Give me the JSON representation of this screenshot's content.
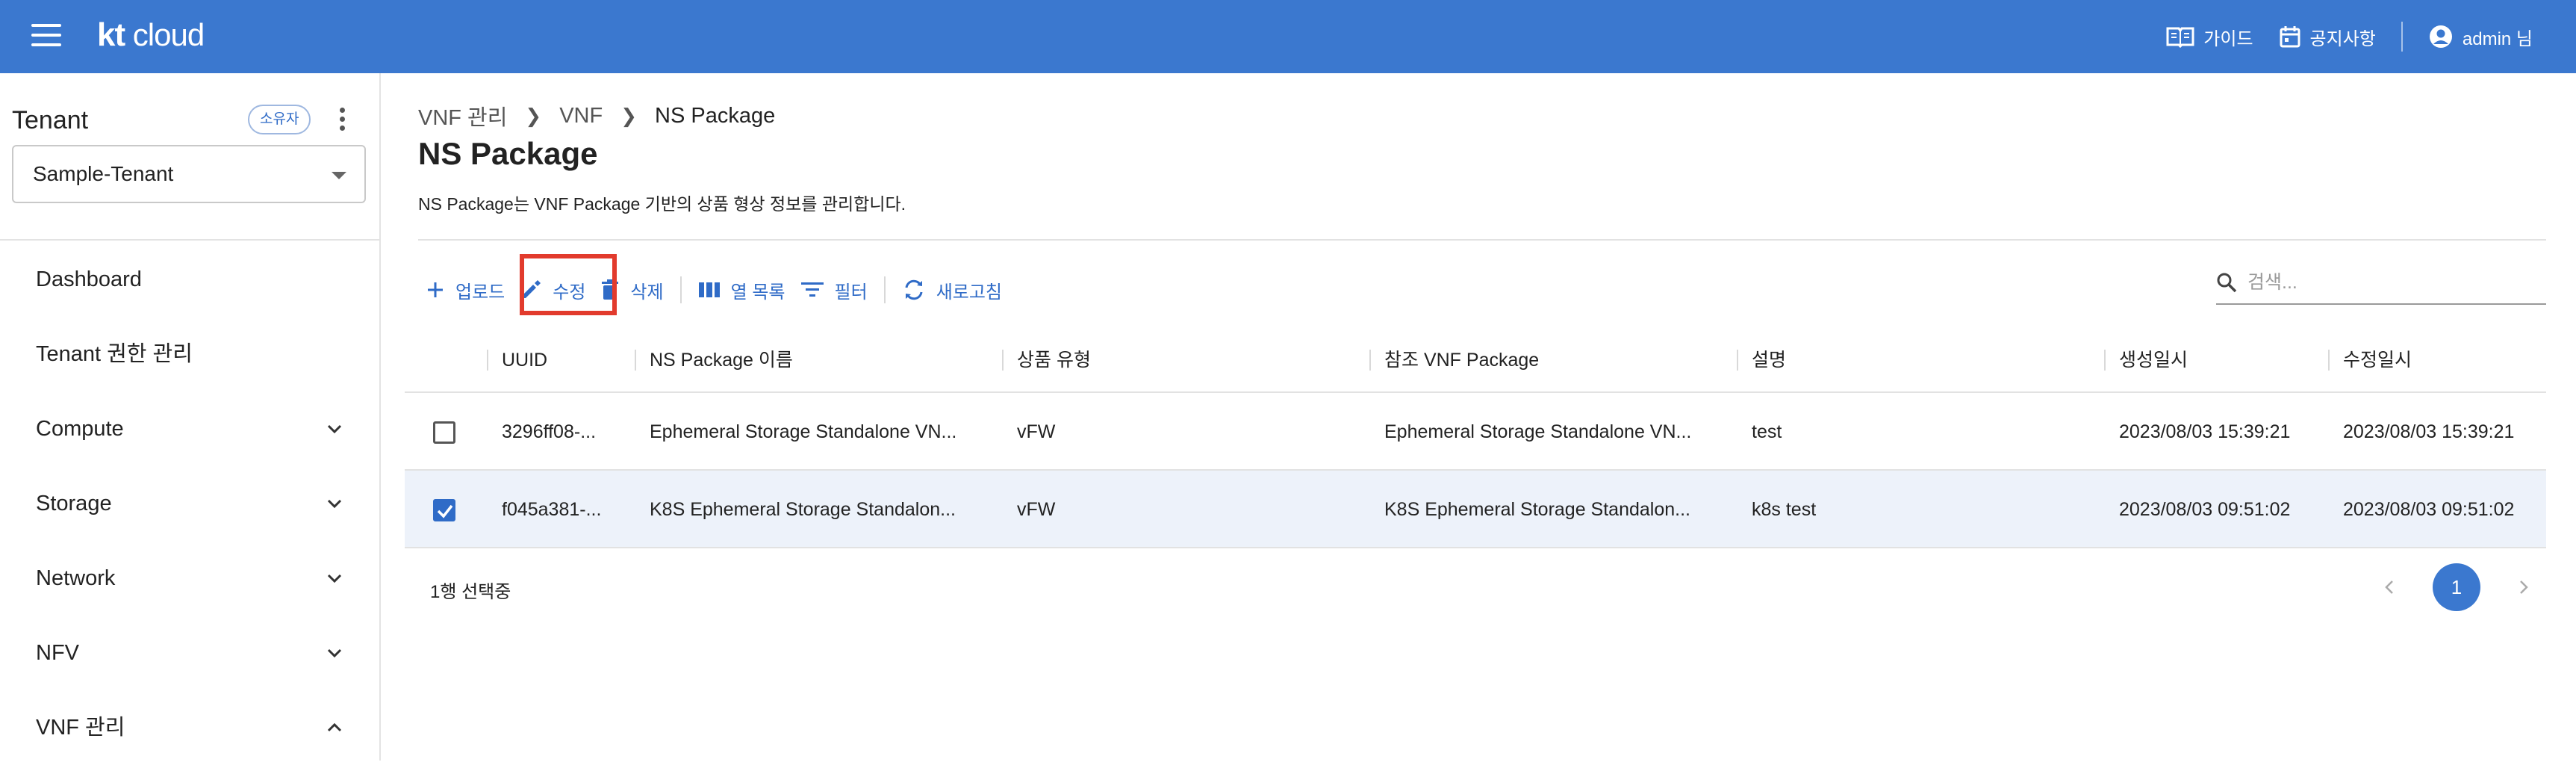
{
  "header": {
    "logo_kt": "kt",
    "logo_cloud": "cloud",
    "guide": "가이드",
    "notice": "공지사항",
    "user": "admin 님"
  },
  "sidebar": {
    "tenant_title": "Tenant",
    "owner_badge": "소유자",
    "tenant_selected": "Sample-Tenant",
    "items": [
      {
        "label": "Dashboard"
      },
      {
        "label": "Tenant 권한 관리"
      },
      {
        "label": "Compute"
      },
      {
        "label": "Storage"
      },
      {
        "label": "Network"
      },
      {
        "label": "NFV"
      },
      {
        "label": "VNF 관리"
      }
    ]
  },
  "breadcrumb": [
    "VNF 관리",
    "VNF",
    "NS Package"
  ],
  "page": {
    "title": "NS Package",
    "description": "NS Package는 VNF Package 기반의 상품 형상 정보를 관리합니다."
  },
  "toolbar": {
    "upload": "업로드",
    "edit": "수정",
    "delete": "삭제",
    "columns": "열 목록",
    "filter": "필터",
    "refresh": "새로고침"
  },
  "search": {
    "placeholder": "검색..."
  },
  "table": {
    "columns": [
      "UUID",
      "NS Package 이름",
      "상품 유형",
      "참조 VNF Package",
      "설명",
      "생성일시",
      "수정일시"
    ],
    "rows": [
      {
        "uuid": "3296ff08-...",
        "name": "Ephemeral Storage Standalone VN...",
        "type": "vFW",
        "ref": "Ephemeral Storage Standalone VN...",
        "desc": "test",
        "created": "2023/08/03 15:39:21",
        "modified": "2023/08/03 15:39:21",
        "checked": false
      },
      {
        "uuid": "f045a381-...",
        "name": "K8S Ephemeral Storage Standalon...",
        "type": "vFW",
        "ref": "K8S Ephemeral Storage Standalon...",
        "desc": "k8s test",
        "created": "2023/08/03 09:51:02",
        "modified": "2023/08/03 09:51:02",
        "checked": true
      }
    ]
  },
  "footer": {
    "selected_text": "1행 선택중",
    "current_page": "1"
  },
  "colors": {
    "accent": "#3b78cf",
    "highlight": "#e23b2d",
    "selected_row": "#edf2fa"
  }
}
